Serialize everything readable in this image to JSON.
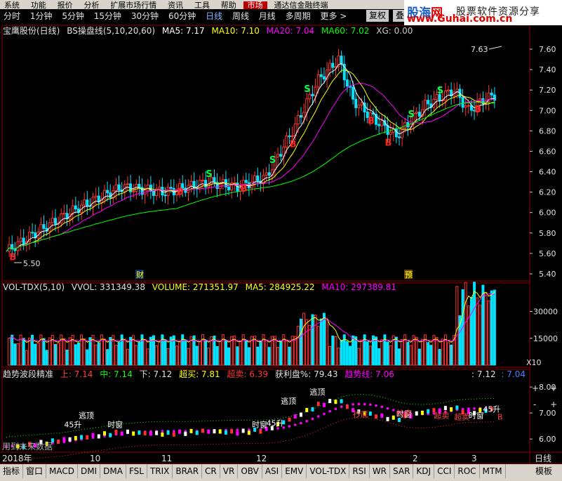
{
  "menu": {
    "items": [
      "系统",
      "功能",
      "报价",
      "分析",
      "扩展市场行情",
      "资讯",
      "工具",
      "帮助"
    ],
    "active": "市场",
    "extra": "通达信金融终端"
  },
  "brand": {
    "logo_a": "股海",
    "logo_b": "网",
    "tagline": "股票软件资源分享",
    "url": "www.Guhai.com.cn"
  },
  "periods": {
    "items": [
      "分时",
      "1分钟",
      "5分钟",
      "15分钟",
      "30分钟",
      "60分钟",
      "日线",
      "周线",
      "月线",
      "多周期",
      "更多 >"
    ],
    "selected": "日线"
  },
  "right_buttons": [
    "复权",
    "叠加"
  ],
  "main_panel": {
    "legend": [
      {
        "text": "宝鹰股份(日线)",
        "color": "#e0e0e0"
      },
      {
        "text": "BS操盘线(5,10,20,60)",
        "color": "#e0e0e0"
      },
      {
        "text": "MA5: 7.17",
        "color": "#ffffff"
      },
      {
        "text": "MA10: 7.10",
        "color": "#ffff00"
      },
      {
        "text": "MA20: 7.04",
        "color": "#ff00ff"
      },
      {
        "text": "MA60: 7.02",
        "color": "#00ff00"
      },
      {
        "text": "XG: 0.00",
        "color": "#c8c8c8"
      }
    ],
    "y_ticks": [
      "7.60",
      "7.40",
      "7.20",
      "7.00",
      "6.80",
      "6.60",
      "6.40",
      "6.20",
      "6.00",
      "5.80",
      "5.60",
      "5.40"
    ],
    "high_label": "7.63",
    "low_label": "5.50",
    "marker_cai": "财",
    "marker_yu": "预"
  },
  "vol_panel": {
    "legend": [
      {
        "text": "VOL-TDX(5,10)",
        "color": "#e0e0e0"
      },
      {
        "text": "VVOL: 331349.38",
        "color": "#e0e0e0"
      },
      {
        "text": "VOLUME: 271351.97",
        "color": "#ffff00"
      },
      {
        "text": "MA5: 284925.22",
        "color": "#ffff00"
      },
      {
        "text": "MA10: 297389.81",
        "color": "#ff00ff"
      }
    ],
    "y_ticks": [
      "30000",
      "15000"
    ],
    "unit": "X10"
  },
  "ind_panel": {
    "legend": [
      {
        "text": "趋势波段精准",
        "color": "#e0e0e0"
      },
      {
        "text": "上: 7.14",
        "color": "#ff4040"
      },
      {
        "text": "中: 7.14",
        "color": "#00ff00"
      },
      {
        "text": "下: 7.12",
        "color": "#e0e0e0"
      },
      {
        "text": "超买: 7.81",
        "color": "#ffff00"
      },
      {
        "text": "超卖: 6.39",
        "color": "#ff3030"
      },
      {
        "text": "获利盘%: 79.43",
        "color": "#e0e0e0"
      },
      {
        "text": "趋势线: 7.06",
        "color": "#ff00ff"
      }
    ],
    "right_vals": [
      {
        "text": ": 7.12",
        "color": "#e0e0e0"
      },
      {
        "text": ": 7.04",
        "color": "#4080ff"
      }
    ],
    "y_ticks": [
      "8.00",
      "7.00",
      "6.00"
    ],
    "notes": [
      "用到未来数据"
    ],
    "labels": [
      "逃顶",
      "逃顶",
      "逃顶",
      "45升",
      "45升",
      "45升",
      "时窗",
      "时窗",
      "时窗",
      "时窗",
      "超卖",
      "超卖",
      "抄底",
      "抄底",
      "B"
    ]
  },
  "x_axis": {
    "labels": [
      "2018年",
      "10",
      "11",
      "12",
      "2",
      "3"
    ],
    "period": "日线"
  },
  "side_buttons": [
    "+",
    "+",
    "-",
    "+"
  ],
  "bottom_tabs": [
    "指标",
    "窗口",
    "MACD",
    "DMI",
    "DMA",
    "FSL",
    "TRIX",
    "BRAR",
    "CR",
    "VR",
    "OBV",
    "ASI",
    "EMV",
    "VOL-TDX",
    "RSI",
    "WR",
    "SAR",
    "KDJ",
    "CCI",
    "ROC",
    "MTM",
    "模板"
  ],
  "colors": {
    "up": "#ff3232",
    "down": "#00e4ff",
    "ma5": "#ffffff",
    "ma10": "#ffff00",
    "ma20": "#ff00ff",
    "ma60": "#00ff00",
    "grid": "#8b0000"
  },
  "signal_labels": {
    "buy": "B",
    "sell": "S"
  }
}
